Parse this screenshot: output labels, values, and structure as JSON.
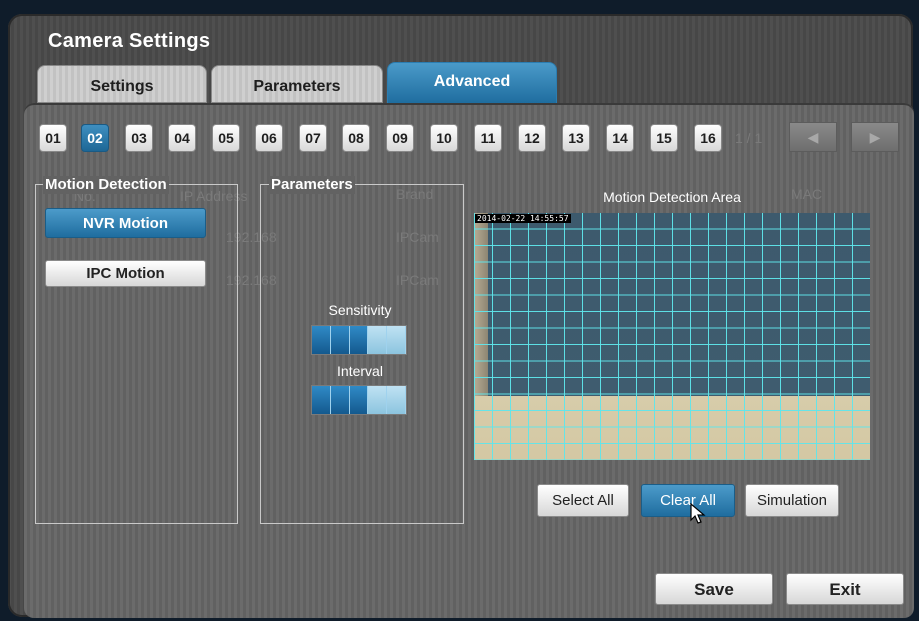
{
  "window": {
    "title": "Camera Settings"
  },
  "tabs": [
    "Settings",
    "Parameters",
    "Advanced"
  ],
  "active_tab": "Advanced",
  "channels": [
    "01",
    "02",
    "03",
    "04",
    "05",
    "06",
    "07",
    "08",
    "09",
    "10",
    "11",
    "12",
    "13",
    "14",
    "15",
    "16"
  ],
  "active_channel": "02",
  "background_ghost": {
    "no": "No.",
    "address": "IP Address",
    "brand": "Brand",
    "mac": "MAC",
    "row1_ip": "192.168",
    "row1_brand": "IPCam",
    "row2_ip": "192.168",
    "row2_brand": "IPCam",
    "page": "1 / 1",
    "nav_prev": "◀",
    "nav_next": "▶"
  },
  "motion_detection": {
    "legend": "Motion Detection",
    "nvr_motion": "NVR Motion",
    "ipc_motion": "IPC Motion",
    "selected": "NVR Motion"
  },
  "parameters": {
    "legend": "Parameters",
    "sensitivity_label": "Sensitivity",
    "sensitivity_level": 3,
    "interval_label": "Interval",
    "interval_level": 3,
    "max_level": 5
  },
  "detection_area": {
    "title": "Motion Detection Area",
    "timestamp": "2014-02-22 14:55:57",
    "select_all": "Select All",
    "clear_all": "Clear All",
    "simulation": "Simulation"
  },
  "footer": {
    "save": "Save",
    "exit": "Exit"
  },
  "colors": {
    "accent": "#1f6d9f",
    "grid": "#5fe6eb"
  }
}
